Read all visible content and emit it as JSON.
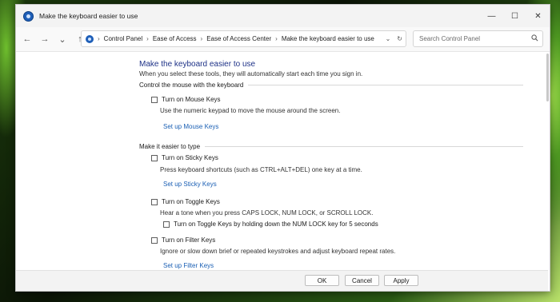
{
  "window": {
    "title": "Make the keyboard easier to use"
  },
  "controls": {
    "minimize": "—",
    "maximize": "☐",
    "close": "✕"
  },
  "nav": {
    "back": "←",
    "forward": "→",
    "recent": "⌄",
    "up": "↑"
  },
  "address": {
    "crumbs": [
      "Control Panel",
      "Ease of Access",
      "Ease of Access Center",
      "Make the keyboard easier to use"
    ],
    "separator": "›",
    "dropdown": "⌄",
    "refresh": "↻"
  },
  "search": {
    "placeholder": "Search Control Panel"
  },
  "page": {
    "heading": "Make the keyboard easier to use",
    "subtitle": "When you select these tools, they will automatically start each time you sign in."
  },
  "sections": [
    {
      "title": "Control the mouse with the keyboard",
      "mouse_keys": {
        "label": "Turn on Mouse Keys",
        "desc": "Use the numeric keypad to move the mouse around the screen.",
        "link": "Set up Mouse Keys"
      }
    },
    {
      "title": "Make it easier to type",
      "sticky_keys": {
        "label": "Turn on Sticky Keys",
        "desc": "Press keyboard shortcuts (such as CTRL+ALT+DEL) one key at a time.",
        "link": "Set up Sticky Keys"
      },
      "toggle_keys": {
        "label": "Turn on Toggle Keys",
        "desc": "Hear a tone when you press CAPS LOCK, NUM LOCK, or SCROLL LOCK.",
        "sub_label": "Turn on Toggle Keys by holding down the NUM LOCK key for 5 seconds"
      },
      "filter_keys": {
        "label": "Turn on Filter Keys",
        "desc": "Ignore or slow down brief or repeated keystrokes and adjust keyboard repeat rates.",
        "link": "Set up Filter Keys"
      }
    }
  ],
  "footer": {
    "ok": "OK",
    "cancel": "Cancel",
    "apply": "Apply"
  },
  "colors": {
    "heading": "#1e3287",
    "link": "#1a5fb4",
    "accent": "#1f5fb8"
  }
}
